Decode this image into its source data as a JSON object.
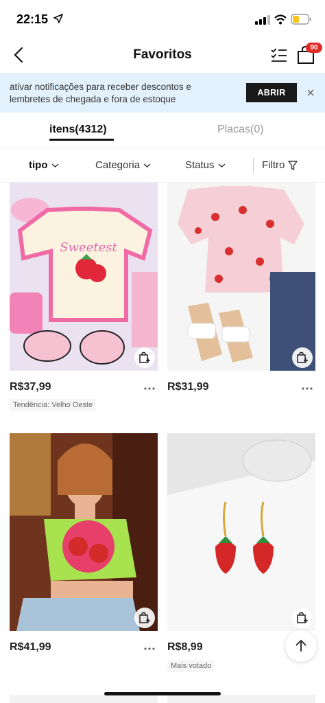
{
  "status_bar": {
    "time": "22:15"
  },
  "header": {
    "title": "Favoritos",
    "cart_count": "90"
  },
  "banner": {
    "text": "ativar notificações para receber descontos e lembretes de chegada e fora de estoque",
    "button_label": "ABRIR"
  },
  "tabs": [
    {
      "label": "itens(4312)",
      "active": true
    },
    {
      "label": "Placas(0)",
      "active": false
    }
  ],
  "filters": {
    "tipo": "tipo",
    "categoria": "Categoria",
    "status": "Status",
    "filtro": "Filtro"
  },
  "products": [
    {
      "price": "R$37,99",
      "tag": "Tendência: Velho Oeste",
      "image": "pink strawberry t-shirt outfit"
    },
    {
      "price": "R$31,99",
      "tag": "",
      "image": "strawberry print top with sandals and jeans"
    },
    {
      "price": "R$41,99",
      "tag": "",
      "image": "model in green strawberry crop top"
    },
    {
      "price": "R$8,99",
      "tag": "Mais votado",
      "image": "strawberry earrings"
    }
  ],
  "colors": {
    "accent_badge": "#e02b2b",
    "banner_bg": "#e3f1fc",
    "button_dark": "#1a1a1a"
  }
}
